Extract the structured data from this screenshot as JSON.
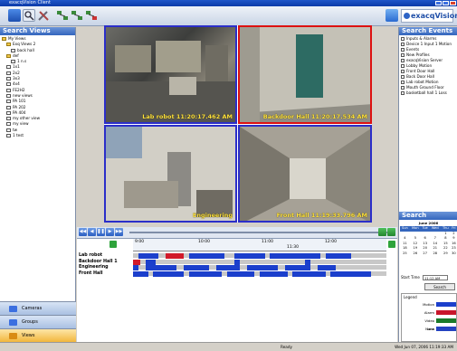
{
  "window": {
    "title": "exacqVision Client"
  },
  "brand": {
    "name": "exacqVision"
  },
  "search_views": {
    "header": "Search Views",
    "items": [
      {
        "label": "My Views",
        "indent": 0,
        "type": "folder"
      },
      {
        "label": "Exq Views 2",
        "indent": 1,
        "type": "folder"
      },
      {
        "label": "back hall",
        "indent": 2,
        "type": "cam"
      },
      {
        "label": "def",
        "indent": 1,
        "type": "folder"
      },
      {
        "label": "1 n.s",
        "indent": 2,
        "type": "cam"
      },
      {
        "label": "1x1",
        "indent": 1,
        "type": "cam"
      },
      {
        "label": "2x2",
        "indent": 1,
        "type": "cam"
      },
      {
        "label": "3x3",
        "indent": 1,
        "type": "cam"
      },
      {
        "label": "4x4",
        "indent": 1,
        "type": "cam"
      },
      {
        "label": "FE2H2",
        "indent": 1,
        "type": "cam"
      },
      {
        "label": "new views",
        "indent": 1,
        "type": "cam"
      },
      {
        "label": "PA 101",
        "indent": 1,
        "type": "cam"
      },
      {
        "label": "PA 202",
        "indent": 1,
        "type": "cam"
      },
      {
        "label": "PA 404",
        "indent": 1,
        "type": "cam"
      },
      {
        "label": "my other view",
        "indent": 1,
        "type": "cam"
      },
      {
        "label": "my view",
        "indent": 1,
        "type": "cam"
      },
      {
        "label": "tw",
        "indent": 1,
        "type": "cam"
      },
      {
        "label": "1 test",
        "indent": 1,
        "type": "cam"
      }
    ]
  },
  "nav": {
    "cameras": "Cameras",
    "groups": "Groups",
    "views": "Views"
  },
  "video": {
    "cells": [
      {
        "label": "Lab robot 11:20:17.462 AM",
        "border": "blue"
      },
      {
        "label": "Backdoor Hall 11:20:17.534 AM",
        "border": "red"
      },
      {
        "label": "Engineering",
        "border": "blue"
      },
      {
        "label": "Front Hall 11:19:33.796 AM",
        "border": "blue"
      }
    ]
  },
  "timeline": {
    "ticks": [
      "9:00",
      "10:00",
      "11:00",
      "12:00"
    ],
    "sub_tick": "11:30",
    "rows": [
      {
        "name": "Lab robot",
        "segments": [
          [
            0.02,
            0.1,
            "b"
          ],
          [
            0.13,
            0.2,
            "r"
          ],
          [
            0.22,
            0.36,
            "b"
          ],
          [
            0.4,
            0.52,
            "b"
          ],
          [
            0.54,
            0.74,
            "b"
          ],
          [
            0.76,
            0.86,
            "b"
          ]
        ]
      },
      {
        "name": "Backdoor Hall 1",
        "segments": [
          [
            0.0,
            0.03,
            "r"
          ],
          [
            0.05,
            0.09,
            "b"
          ],
          [
            0.4,
            0.42,
            "b"
          ],
          [
            0.68,
            0.7,
            "b"
          ]
        ]
      },
      {
        "name": "Engineering",
        "segments": [
          [
            0.0,
            0.02,
            "b"
          ],
          [
            0.05,
            0.17,
            "b"
          ],
          [
            0.2,
            0.3,
            "b"
          ],
          [
            0.33,
            0.42,
            "b"
          ],
          [
            0.45,
            0.57,
            "b"
          ],
          [
            0.6,
            0.7,
            "b"
          ],
          [
            0.73,
            0.8,
            "b"
          ]
        ]
      },
      {
        "name": "Front Hall",
        "segments": [
          [
            0.0,
            0.06,
            "b"
          ],
          [
            0.08,
            0.2,
            "b"
          ],
          [
            0.22,
            0.35,
            "b"
          ],
          [
            0.37,
            0.48,
            "b"
          ],
          [
            0.5,
            0.61,
            "b"
          ],
          [
            0.63,
            0.76,
            "b"
          ],
          [
            0.78,
            0.94,
            "b"
          ]
        ]
      }
    ]
  },
  "search_events": {
    "header": "Search Events",
    "items": [
      "Inputs & Alarms",
      "Device 1 Input 1 Motion",
      "Events",
      "New Profiles",
      "exacqVision Server",
      "Lobby Motion",
      "Front Door Hall",
      "Back Door Hall",
      "Lab robot Motion",
      "Mouth Ground Floor",
      "basketball hall 1 Loss"
    ]
  },
  "pos": {
    "header": "Search POS/ATM"
  },
  "calendar": {
    "title": "June 2006",
    "days": [
      "Sun",
      "Mon",
      "Tue",
      "Wed",
      "Thu",
      "Fri"
    ],
    "weeks": [
      [
        "",
        "",
        "",
        "",
        "1",
        "2"
      ],
      [
        "4",
        "5",
        "6",
        "7",
        "8",
        "9"
      ],
      [
        "11",
        "12",
        "13",
        "14",
        "15",
        "16"
      ],
      [
        "18",
        "19",
        "20",
        "21",
        "22",
        "23"
      ],
      [
        "25",
        "26",
        "27",
        "28",
        "29",
        "30"
      ]
    ]
  },
  "search_controls": {
    "start_label": "Start Time",
    "start_value": "11:12 AM",
    "search_button": "Search"
  },
  "legend": {
    "title": "Legend",
    "items": [
      {
        "name": "Motion",
        "color": "#1b3fcc"
      },
      {
        "name": "Alarm",
        "color": "#c8162a"
      },
      {
        "name": "Video Loss",
        "color": "#1a7a2a"
      },
      {
        "name": "None",
        "color": "#2442c0"
      }
    ]
  },
  "status": {
    "center": "Ready",
    "right": "Wed Jun 07, 2006   11:19:33 AM"
  },
  "colors": {
    "accent": "#3466bd",
    "motion": "#1b3fcc",
    "alarm": "#d11a2a",
    "track": "#c8c8c8"
  }
}
